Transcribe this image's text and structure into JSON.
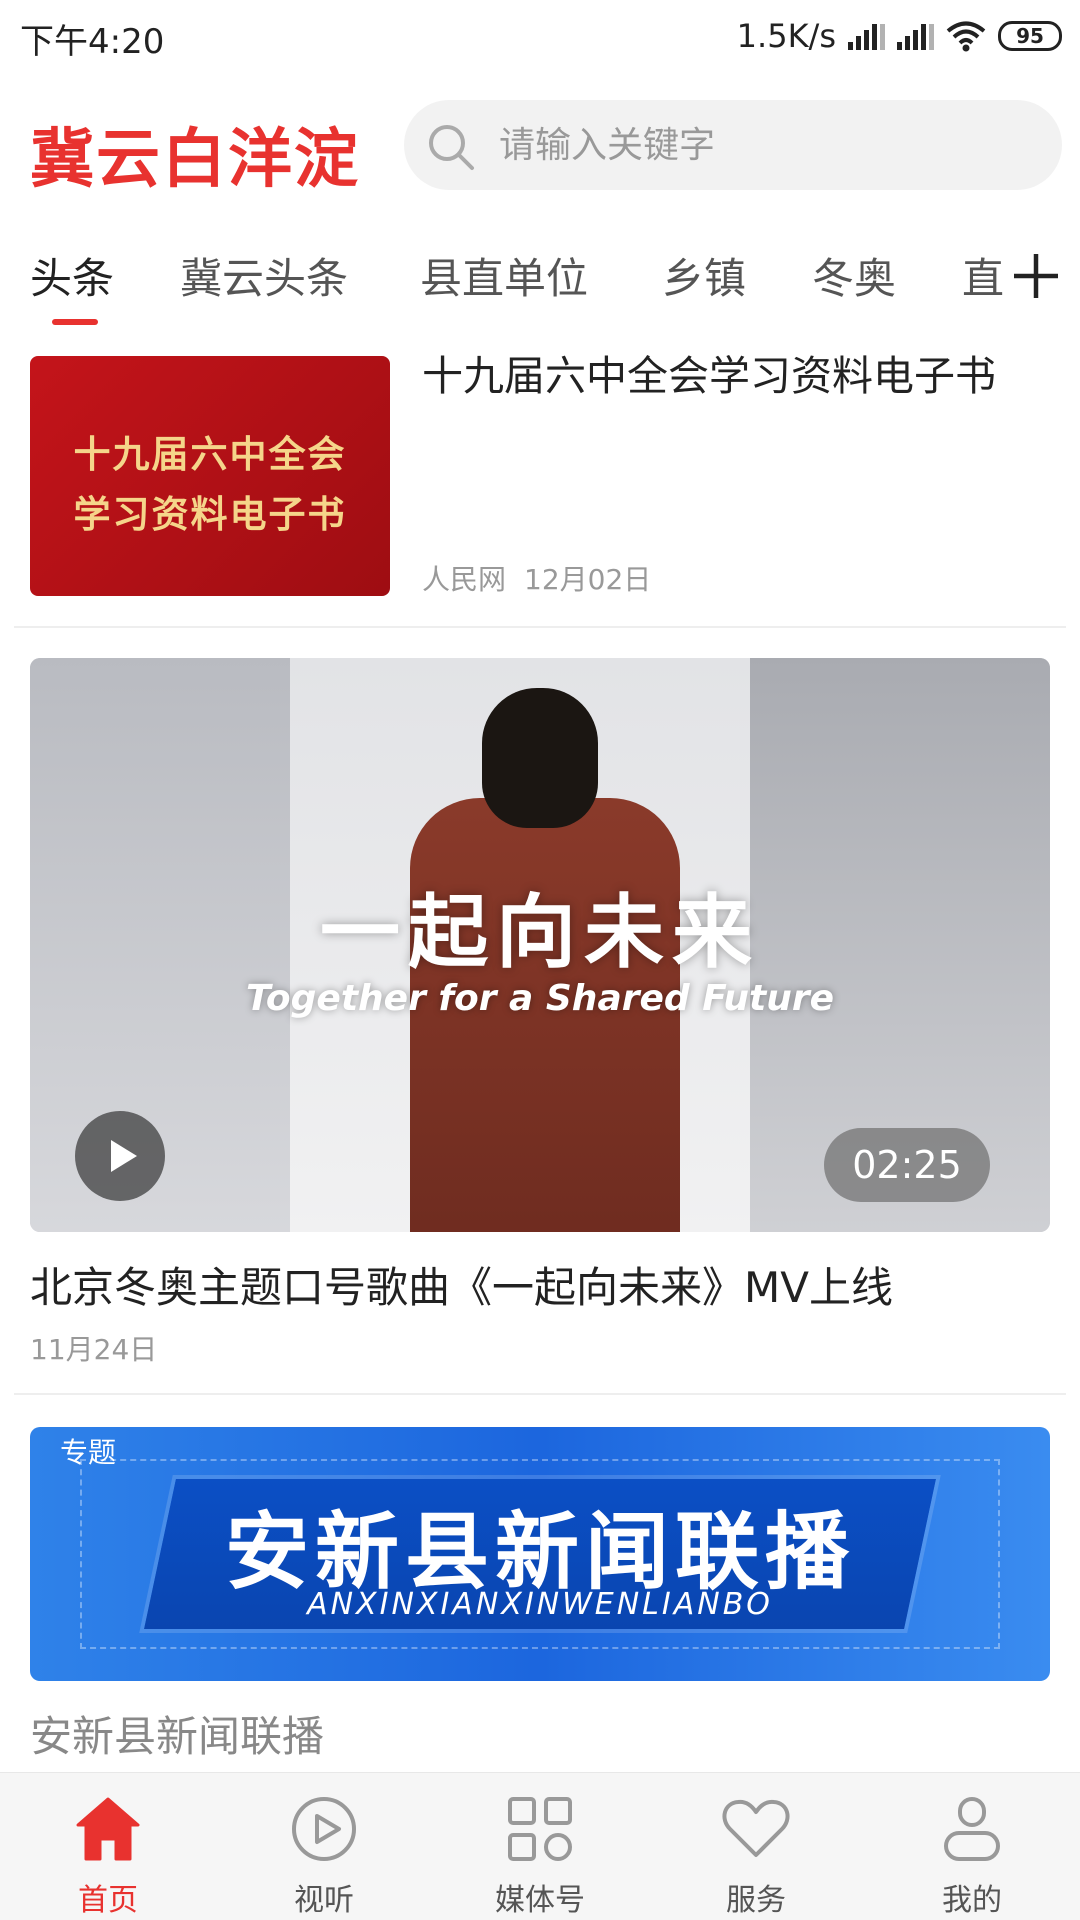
{
  "status_bar": {
    "time": "下午4:20",
    "net_speed": "1.5K/s",
    "battery": "95"
  },
  "header": {
    "logo": "冀云白洋淀",
    "search_placeholder": "请输入关键字"
  },
  "tabs": {
    "items": [
      "头条",
      "冀云头条",
      "县直单位",
      "乡镇",
      "冬奥",
      "直"
    ],
    "active_index": 0
  },
  "feed": {
    "article1": {
      "title": "十九届六中全会学习资料电子书",
      "thumb_line1": "十九届六中全会",
      "thumb_line2": "学习资料电子书",
      "source": "人民网",
      "date": "12月02日"
    },
    "article2": {
      "video_title_cn": "一起向未来",
      "video_title_en": "Together for a Shared Future",
      "duration": "02:25",
      "title": "北京冬奥主题口号歌曲《一起向未来》MV上线",
      "date": "11月24日"
    },
    "article3": {
      "tag": "专题",
      "banner_cn": "安新县新闻联播",
      "banner_en": "ANXINXIANXINWENLIANBO",
      "title": "安新县新闻联播"
    }
  },
  "bottom_nav": {
    "items": [
      "首页",
      "视听",
      "媒体号",
      "服务",
      "我的"
    ],
    "active_index": 0
  },
  "colors": {
    "brand_red": "#e8322f",
    "banner_blue": "#1c66de"
  },
  "icons": [
    "search-icon",
    "plus-icon",
    "play-icon",
    "home-icon",
    "play-circle-icon",
    "grid-icon",
    "heart-icon",
    "user-icon"
  ]
}
